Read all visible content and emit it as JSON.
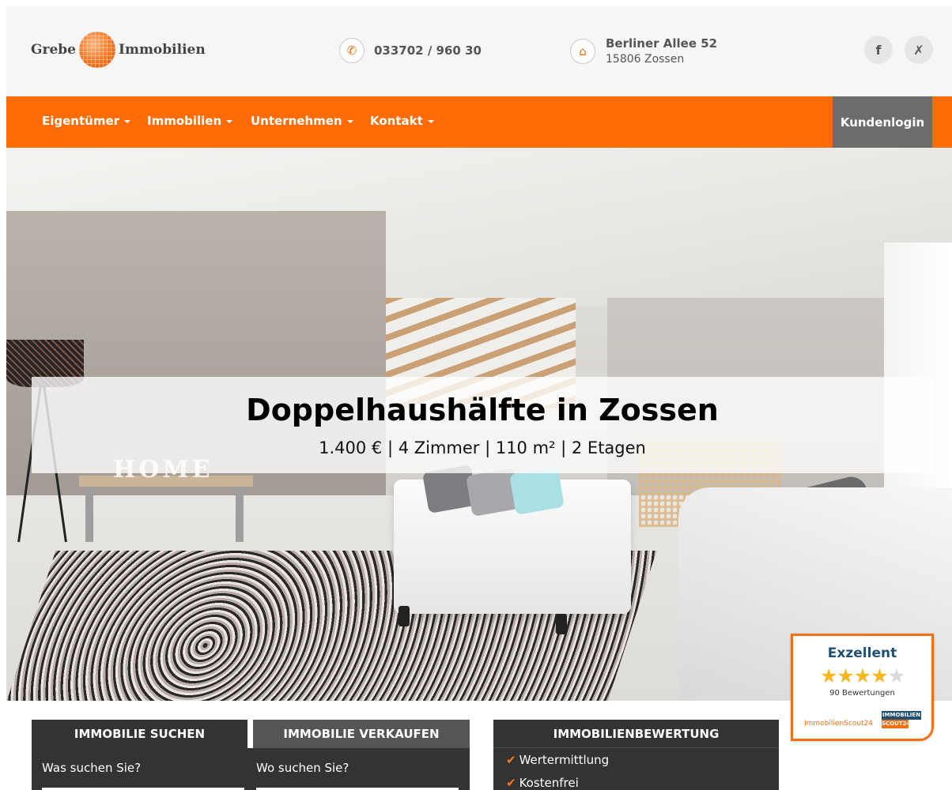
{
  "header": {
    "logo_left": "Grebe",
    "logo_right": "Immobilien",
    "phone": "033702 / 960 30",
    "address_street": "Berliner Allee 52",
    "address_city": "15806 Zossen",
    "social": [
      {
        "name": "facebook-icon",
        "glyph": "f"
      },
      {
        "name": "xing-icon",
        "glyph": "✗"
      }
    ]
  },
  "nav": {
    "items": [
      "Eigentümer",
      "Immobilien",
      "Unternehmen",
      "Kontakt"
    ],
    "login": "Kundenlogin",
    "accent": "#ff6b05"
  },
  "hero": {
    "title": "Doppelhaushälfte in Zossen",
    "subtitle": "1.400 € | 4 Zimmer | 110 m² | 2 Etagen",
    "decor_text": "HOME"
  },
  "search_panel": {
    "tab_search": "IMMOBILIE SUCHEN",
    "tab_sell": "IMMOBILIE VERKAUFEN",
    "what_label": "Was suchen Sie?",
    "where_label": "Wo suchen Sie?"
  },
  "evaluation": {
    "title": "IMMOBILIENBEWERTUNG",
    "items": [
      "Wertermittlung",
      "Kostenfrei"
    ]
  },
  "rating_badge": {
    "title": "Exzellent",
    "stars": "4.5",
    "count": "90 Bewertungen",
    "brand": "ImmobilienScout24",
    "logo_top": "IMMOBILIEN",
    "logo_bottom": "SCOUT24"
  }
}
